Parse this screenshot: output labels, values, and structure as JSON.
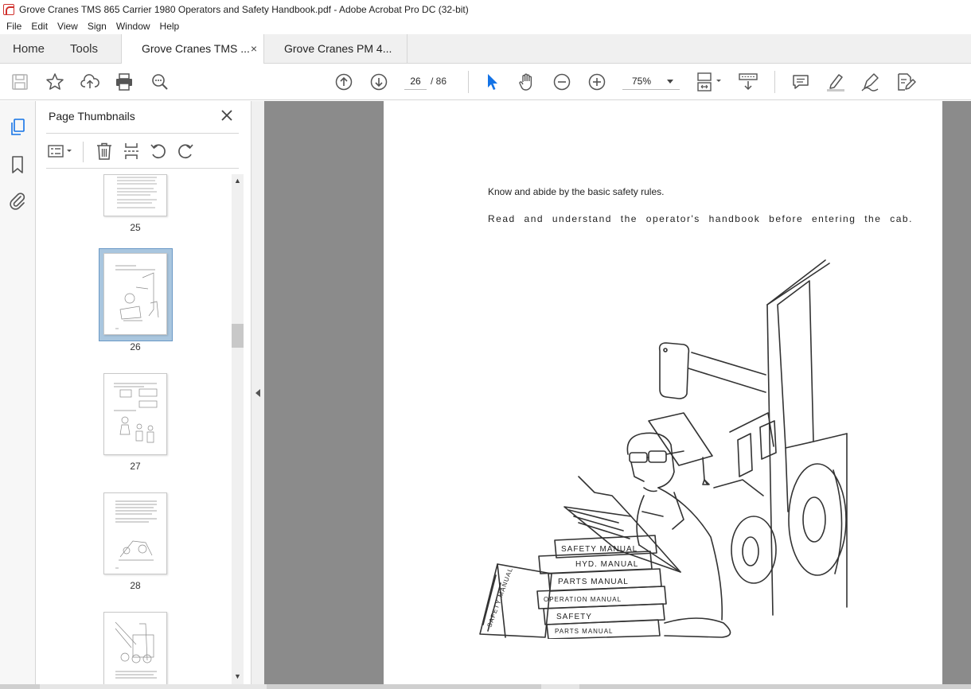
{
  "window": {
    "title": "Grove Cranes TMS 865 Carrier 1980 Operators and Safety Handbook.pdf - Adobe Acrobat Pro DC (32-bit)"
  },
  "menu": {
    "items": [
      "File",
      "Edit",
      "View",
      "Sign",
      "Window",
      "Help"
    ]
  },
  "tabs": {
    "home": "Home",
    "tools": "Tools",
    "documents": [
      {
        "label": "Grove Cranes TMS ...",
        "active": true
      },
      {
        "label": "Grove Cranes PM 4...",
        "active": false
      }
    ],
    "close_glyph": "×"
  },
  "toolbar": {
    "current_page": "26",
    "page_separator": "/ 86",
    "zoom": "75%",
    "icons": [
      "save-icon",
      "bookmark-star-icon",
      "upload-icon",
      "print-icon",
      "zoom-search-icon",
      "page-up-icon",
      "page-down-icon",
      "select-cursor-icon",
      "hand-icon",
      "zoom-out-icon",
      "zoom-in-icon",
      "page-layout-icon",
      "scroll-mode-icon",
      "comment-icon",
      "highlight-icon",
      "draw-icon",
      "edit-pdf-icon"
    ],
    "accent": "#1473e6"
  },
  "panel": {
    "title": "Page Thumbnails",
    "thumbnails": [
      {
        "label": "25"
      },
      {
        "label": "26",
        "selected": true
      },
      {
        "label": "27"
      },
      {
        "label": "28"
      },
      {
        "label": ""
      }
    ]
  },
  "page": {
    "line1": "Know and abide by the basic safety rules.",
    "line2": "Read and understand the operator's handbook before entering the cab.",
    "illustration": {
      "books": [
        "SAFETY MANUAL",
        "HYD. MANUAL",
        "PARTS MANUAL",
        "OPERATION MANUAL",
        "SAFETY",
        "PARTS MANUAL"
      ],
      "open_book": "SAFETY MANUAL"
    }
  }
}
